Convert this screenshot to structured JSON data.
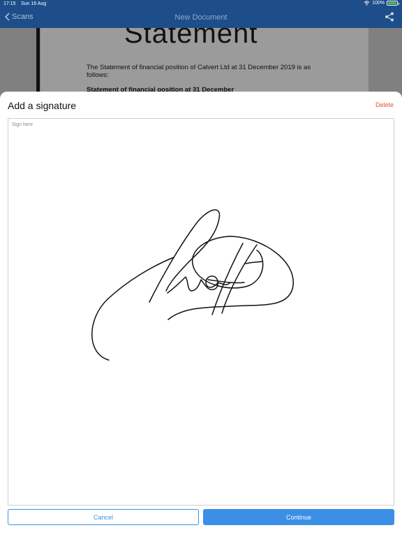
{
  "status_bar": {
    "time": "17:15",
    "date": "Sun 16 Aug",
    "battery": "100%",
    "battery_level": 1.0,
    "icons": [
      "wifi-icon",
      "battery-icon"
    ]
  },
  "nav": {
    "back_label": "Scans",
    "title": "New Document",
    "share_icon": "share-icon"
  },
  "document": {
    "heading": "Statement",
    "paragraph": "The Statement of financial position of Calvert Ltd at 31 December 2019 is as follows:",
    "subheading": "Statement of financial position at 31 December"
  },
  "sheet": {
    "title": "Add a signature",
    "delete_label": "Delete",
    "pad_placeholder": "Sign here",
    "cancel_label": "Cancel",
    "continue_label": "Continue"
  },
  "colors": {
    "nav_bar": "#1d4e89",
    "accent": "#3b8fe6",
    "delete": "#e0552b"
  }
}
